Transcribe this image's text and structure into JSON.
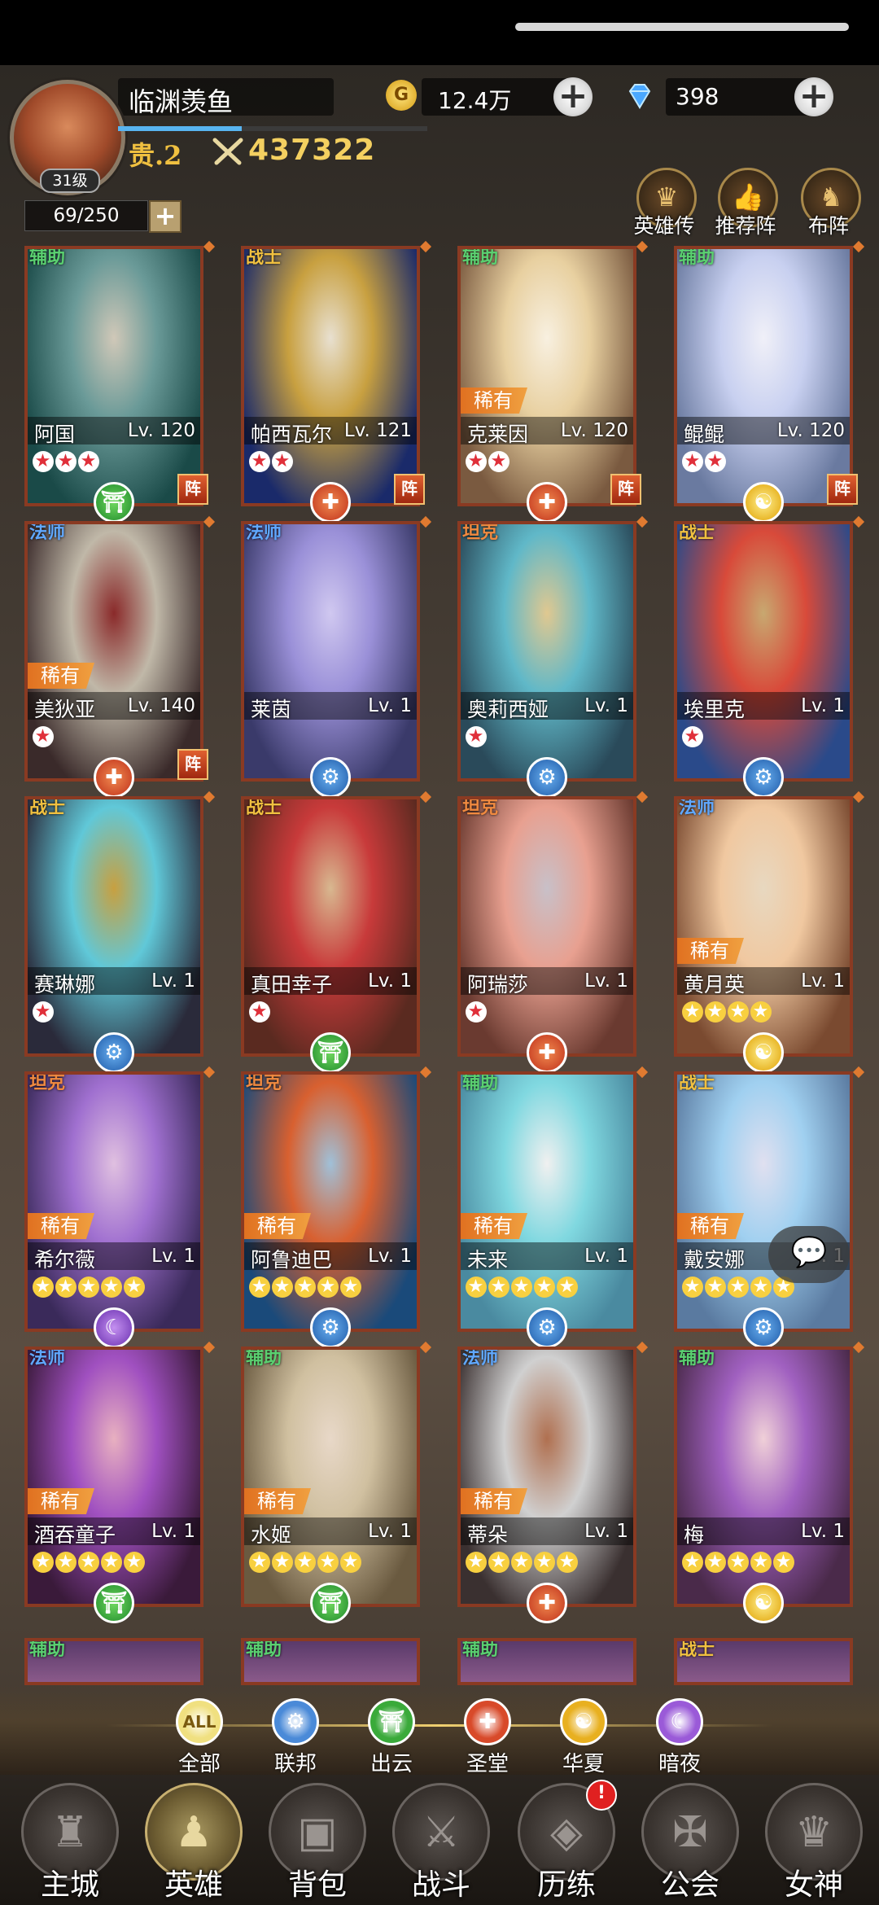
{
  "player": {
    "name": "临渊羡鱼",
    "level_text": "31级",
    "vip": "贵.2",
    "power": "437322",
    "gold": "12.4万",
    "gold_icon": "G",
    "gems": "398",
    "xp_fraction": 0.4
  },
  "roster": {
    "capacity": "69/250"
  },
  "top_buttons": [
    {
      "label": "英雄传",
      "icon": "crown-icon"
    },
    {
      "label": "推荐阵",
      "icon": "thumbs-up-icon"
    },
    {
      "label": "布阵",
      "icon": "knight-icon"
    }
  ],
  "labels": {
    "rare": "稀有",
    "formation": "阵"
  },
  "heroes": [
    {
      "cls": "辅助",
      "name": "阿国",
      "lv": "Lv. 120",
      "stars": 3,
      "star_color": "red",
      "rare": false,
      "faction": "cloud",
      "formation": true
    },
    {
      "cls": "战士",
      "name": "帕西瓦尔",
      "lv": "Lv. 121",
      "stars": 2,
      "star_color": "red",
      "rare": false,
      "faction": "holy",
      "formation": true
    },
    {
      "cls": "辅助",
      "name": "克莱因",
      "lv": "Lv. 120",
      "stars": 2,
      "star_color": "red",
      "rare": true,
      "faction": "holy",
      "formation": true
    },
    {
      "cls": "辅助",
      "name": "鲲鲲",
      "lv": "Lv. 120",
      "stars": 2,
      "star_color": "red",
      "rare": false,
      "faction": "china",
      "formation": true
    },
    {
      "cls": "法师",
      "name": "美狄亚",
      "lv": "Lv. 140",
      "stars": 1,
      "star_color": "red",
      "rare": true,
      "faction": "holy",
      "formation": true
    },
    {
      "cls": "法师",
      "name": "莱茵",
      "lv": "Lv. 1",
      "stars": 0,
      "star_color": "red",
      "rare": false,
      "faction": "union",
      "formation": false
    },
    {
      "cls": "坦克",
      "name": "奥莉西娅",
      "lv": "Lv. 1",
      "stars": 1,
      "star_color": "red",
      "rare": false,
      "faction": "union",
      "formation": false
    },
    {
      "cls": "战士",
      "name": "埃里克",
      "lv": "Lv. 1",
      "stars": 1,
      "star_color": "red",
      "rare": false,
      "faction": "union",
      "formation": false
    },
    {
      "cls": "战士",
      "name": "赛琳娜",
      "lv": "Lv. 1",
      "stars": 1,
      "star_color": "red",
      "rare": false,
      "faction": "union",
      "formation": false
    },
    {
      "cls": "战士",
      "name": "真田幸子",
      "lv": "Lv. 1",
      "stars": 1,
      "star_color": "red",
      "rare": false,
      "faction": "cloud",
      "formation": false
    },
    {
      "cls": "坦克",
      "name": "阿瑞莎",
      "lv": "Lv. 1",
      "stars": 1,
      "star_color": "red",
      "rare": false,
      "faction": "holy",
      "formation": false
    },
    {
      "cls": "法师",
      "name": "黄月英",
      "lv": "Lv. 1",
      "stars": 4,
      "star_color": "gold",
      "rare": true,
      "faction": "china",
      "formation": false
    },
    {
      "cls": "坦克",
      "name": "希尔薇",
      "lv": "Lv. 1",
      "stars": 5,
      "star_color": "gold",
      "rare": true,
      "faction": "night",
      "formation": false
    },
    {
      "cls": "坦克",
      "name": "阿鲁迪巴",
      "lv": "Lv. 1",
      "stars": 5,
      "star_color": "gold",
      "rare": true,
      "faction": "union",
      "formation": false
    },
    {
      "cls": "辅助",
      "name": "未来",
      "lv": "Lv. 1",
      "stars": 5,
      "star_color": "gold",
      "rare": true,
      "faction": "union",
      "formation": false
    },
    {
      "cls": "战士",
      "name": "戴安娜",
      "lv": "Lv. 1",
      "stars": 5,
      "star_color": "gold",
      "rare": true,
      "faction": "union",
      "formation": false
    },
    {
      "cls": "法师",
      "name": "酒吞童子",
      "lv": "Lv. 1",
      "stars": 5,
      "star_color": "gold",
      "rare": true,
      "faction": "cloud",
      "formation": false
    },
    {
      "cls": "辅助",
      "name": "水姬",
      "lv": "Lv. 1",
      "stars": 5,
      "star_color": "gold",
      "rare": true,
      "faction": "cloud",
      "formation": false
    },
    {
      "cls": "法师",
      "name": "蒂朵",
      "lv": "Lv. 1",
      "stars": 5,
      "star_color": "gold",
      "rare": true,
      "faction": "holy",
      "formation": false
    },
    {
      "cls": "辅助",
      "name": "梅",
      "lv": "Lv. 1",
      "stars": 5,
      "star_color": "gold",
      "rare": false,
      "faction": "china",
      "formation": false
    }
  ],
  "partial_heroes": [
    {
      "cls": "辅助"
    },
    {
      "cls": "辅助"
    },
    {
      "cls": "辅助"
    },
    {
      "cls": "战士"
    }
  ],
  "filters": [
    {
      "label": "全部",
      "icon_text": "ALL",
      "color": "#f0e080"
    },
    {
      "label": "联邦",
      "icon_text": "⚙",
      "color": "#4a8ad8"
    },
    {
      "label": "出云",
      "icon_text": "⛩",
      "color": "#3aaa3a"
    },
    {
      "label": "圣堂",
      "icon_text": "✚",
      "color": "#d84a2a"
    },
    {
      "label": "华夏",
      "icon_text": "☯",
      "color": "#e8b020"
    },
    {
      "label": "暗夜",
      "icon_text": "☾",
      "color": "#9a5ad8"
    }
  ],
  "nav": [
    {
      "label": "主城",
      "icon": "castle-icon",
      "glyph": "♜",
      "active": false
    },
    {
      "label": "英雄",
      "icon": "hero-icon",
      "glyph": "♟",
      "active": true
    },
    {
      "label": "背包",
      "icon": "backpack-icon",
      "glyph": "▣",
      "active": false
    },
    {
      "label": "战斗",
      "icon": "swords-icon",
      "glyph": "⚔",
      "active": false
    },
    {
      "label": "历练",
      "icon": "map-icon",
      "glyph": "◈",
      "active": false,
      "badge": "!"
    },
    {
      "label": "公会",
      "icon": "guild-icon",
      "glyph": "✠",
      "active": false
    },
    {
      "label": "女神",
      "icon": "goddess-icon",
      "glyph": "♛",
      "active": false
    }
  ],
  "faction_glyphs": {
    "union": "⚙",
    "cloud": "⛩",
    "holy": "✚",
    "china": "☯",
    "night": "☾"
  },
  "colors": {
    "class_support": "#5ad070",
    "class_warrior": "#f0c040",
    "class_mage": "#60a8ff",
    "class_tank": "#f08a40"
  }
}
